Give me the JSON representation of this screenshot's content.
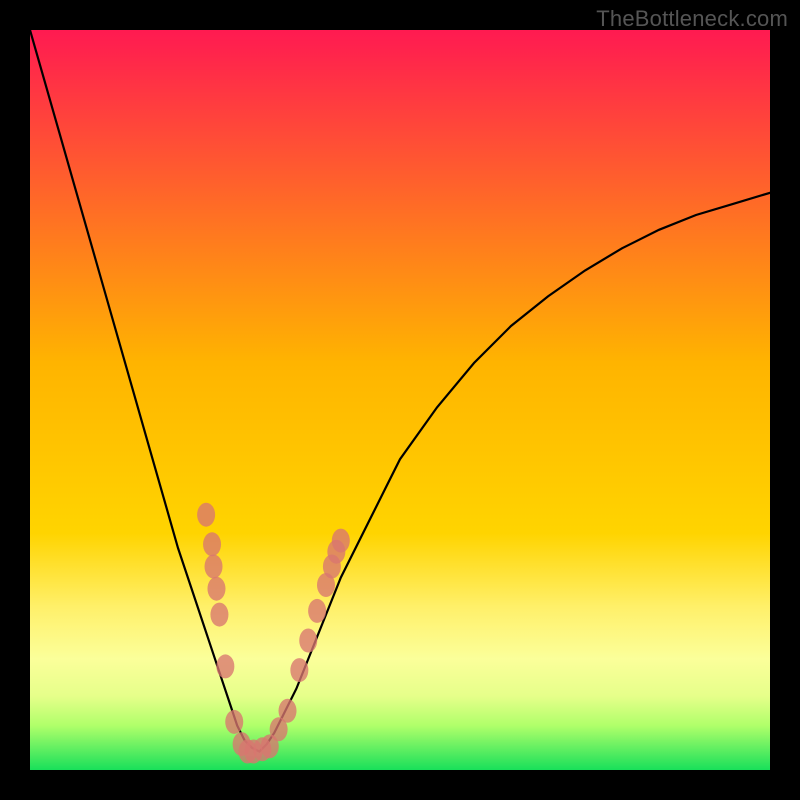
{
  "watermark": "TheBottleneck.com",
  "colors": {
    "frame": "#000000",
    "gradient_top": "#ff1a51",
    "gradient_mid": "#ffd400",
    "gradient_green_band_top": "#f6ff7a",
    "gradient_green_band_bottom": "#18e05a",
    "curve": "#000000",
    "marker_fill": "#d9766f",
    "marker_stroke": "#d9766f"
  },
  "chart_data": {
    "type": "line",
    "title": "",
    "xlabel": "",
    "ylabel": "",
    "xlim": [
      0,
      100
    ],
    "ylim": [
      0,
      100
    ],
    "x": [
      0,
      2,
      4,
      6,
      8,
      10,
      12,
      14,
      16,
      18,
      20,
      22,
      24,
      26,
      27,
      28,
      29,
      30,
      31,
      32,
      33,
      34,
      36,
      38,
      40,
      42,
      44,
      46,
      48,
      50,
      55,
      60,
      65,
      70,
      75,
      80,
      85,
      90,
      95,
      100
    ],
    "values": [
      100,
      93,
      86,
      79,
      72,
      65,
      58,
      51,
      44,
      37,
      30,
      24,
      18,
      12,
      9,
      6,
      4,
      3,
      2.5,
      3.5,
      5,
      7,
      11,
      16,
      21,
      26,
      30,
      34,
      38,
      42,
      49,
      55,
      60,
      64,
      67.5,
      70.5,
      73,
      75,
      76.5,
      78
    ],
    "marker_points": [
      {
        "x": 23.8,
        "y": 34.5
      },
      {
        "x": 24.6,
        "y": 30.5
      },
      {
        "x": 24.8,
        "y": 27.5
      },
      {
        "x": 25.2,
        "y": 24.5
      },
      {
        "x": 25.6,
        "y": 21.0
      },
      {
        "x": 26.4,
        "y": 14.0
      },
      {
        "x": 27.6,
        "y": 6.5
      },
      {
        "x": 28.6,
        "y": 3.5
      },
      {
        "x": 29.4,
        "y": 2.5
      },
      {
        "x": 30.2,
        "y": 2.5
      },
      {
        "x": 31.4,
        "y": 2.8
      },
      {
        "x": 32.4,
        "y": 3.2
      },
      {
        "x": 33.6,
        "y": 5.5
      },
      {
        "x": 34.8,
        "y": 8.0
      },
      {
        "x": 36.4,
        "y": 13.5
      },
      {
        "x": 37.6,
        "y": 17.5
      },
      {
        "x": 38.8,
        "y": 21.5
      },
      {
        "x": 40.0,
        "y": 25.0
      },
      {
        "x": 40.8,
        "y": 27.5
      },
      {
        "x": 41.4,
        "y": 29.5
      },
      {
        "x": 42.0,
        "y": 31.0
      }
    ],
    "green_band": {
      "y0": 0,
      "y1": 4
    },
    "pale_band": {
      "y0": 4,
      "y1": 28
    }
  }
}
